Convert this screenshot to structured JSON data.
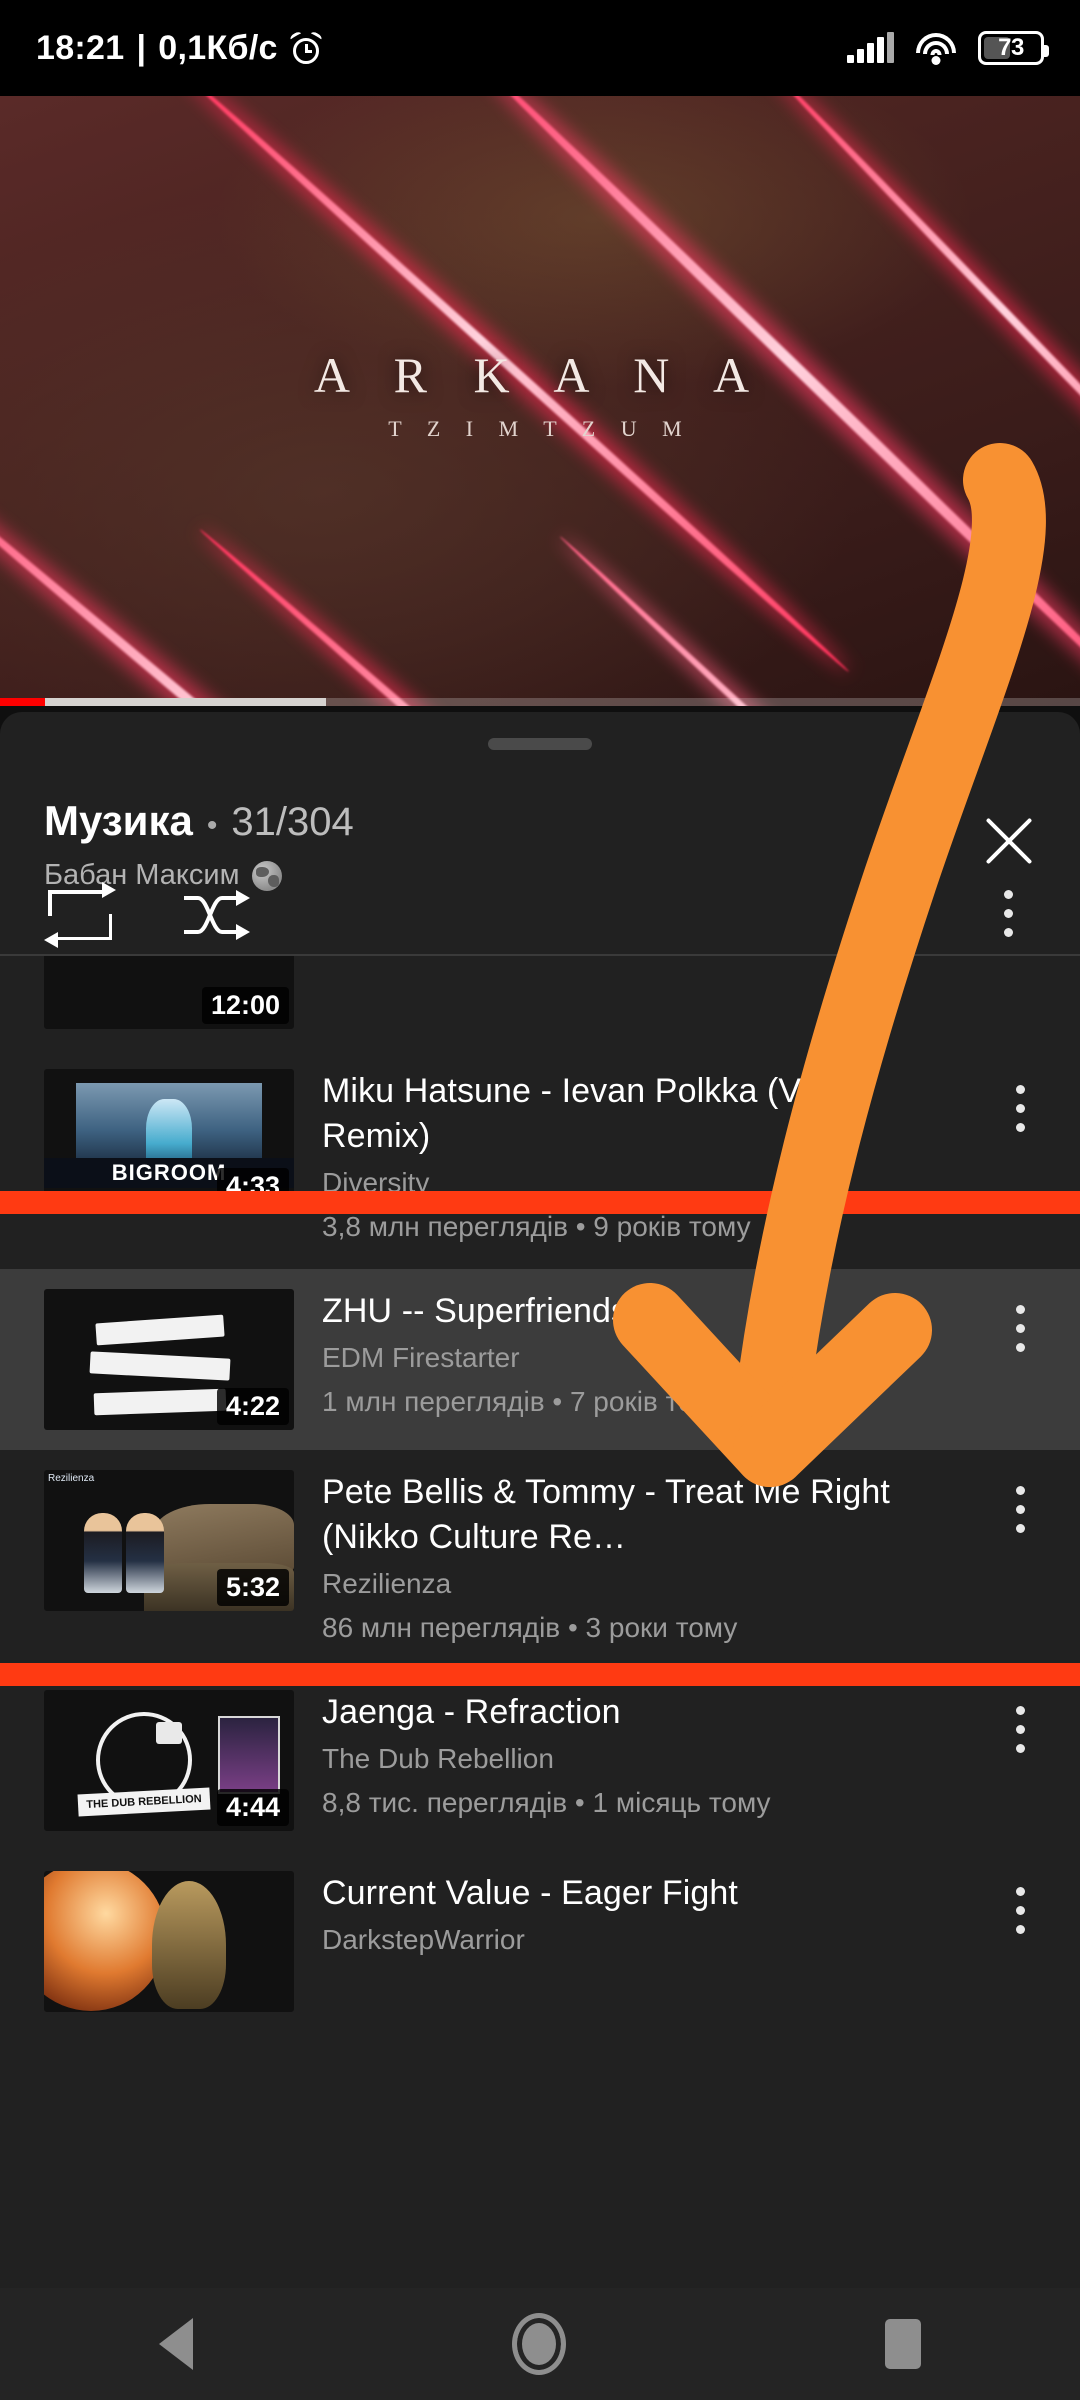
{
  "status_bar": {
    "time": "18:21",
    "separator": "|",
    "network_speed": "0,1Кб/с",
    "alarm_icon": "alarm-clock-icon",
    "signal_icon": "cellular-signal-icon",
    "wifi_icon": "wifi-icon",
    "battery_percent": "73"
  },
  "player": {
    "video_title_main": "A R K A N A",
    "video_title_sub": "T Z I M T Z U M",
    "progress_played_percent": 4.2,
    "progress_buffered_percent": 30.2
  },
  "queue_panel": {
    "grabber": "drag-handle",
    "playlist_name": "Музика",
    "separator_dot": "•",
    "position_count": "31/304",
    "owner": "Бабан Максим",
    "owner_visibility_icon": "globe-public-icon",
    "close_label": "×",
    "repeat_icon": "repeat-icon",
    "shuffle_icon": "shuffle-icon",
    "overflow_icon": "more-vertical-icon"
  },
  "videos": [
    {
      "title": "",
      "channel": "",
      "stats": "",
      "duration": "12:00",
      "active": false,
      "partial": true,
      "thumb": "t-partial"
    },
    {
      "title": "Miku Hatsune - Ievan Polkka (VSNS Remix)",
      "channel": "Diversity",
      "stats": "3,8 млн переглядів • 9 років тому",
      "duration": "4:33",
      "thumb_label": "BIGROOM",
      "active": false,
      "partial": false,
      "thumb": "t-miku"
    },
    {
      "title": "ZHU -- Superfriends",
      "channel": "EDM Firestarter",
      "stats": "1 млн переглядів • 7 років тому",
      "duration": "4:22",
      "active": true,
      "partial": false,
      "thumb": "t-zhu"
    },
    {
      "title": "Pete Bellis & Tommy - Treat Me Right (Nikko Culture Re…",
      "channel": "Rezilienza",
      "stats": "86 млн переглядів • 3 роки тому",
      "duration": "5:32",
      "active": false,
      "partial": false,
      "thumb": "t-pete"
    },
    {
      "title": "Jaenga - Refraction",
      "channel": "The Dub Rebellion",
      "stats": "8,8 тис. переглядів • 1 місяць тому",
      "duration": "4:44",
      "active": false,
      "partial": false,
      "thumb": "t-jaenga"
    },
    {
      "title": "Current Value - Eager Fight",
      "channel": "DarkstepWarrior",
      "stats": "",
      "duration": "",
      "active": false,
      "partial": false,
      "thumb": "t-cv"
    }
  ],
  "annotations": {
    "arrow_color": "#F89132",
    "line_color": "#FF3A12",
    "arrow_name": "orange-curved-down-arrow",
    "line1_name": "red-strike-line-upper",
    "line2_name": "red-strike-line-lower"
  },
  "nav_bar": {
    "back_icon": "back-triangle-icon",
    "home_icon": "home-circle-icon",
    "recents_icon": "recents-square-icon"
  }
}
